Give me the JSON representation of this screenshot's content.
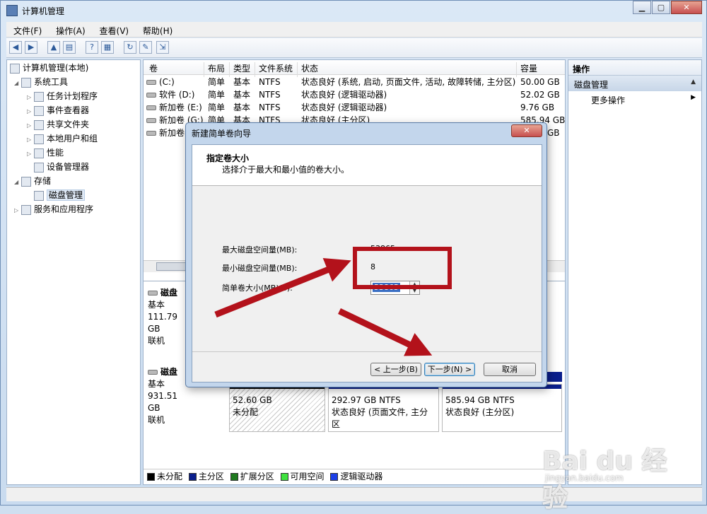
{
  "window": {
    "title": "计算机管理",
    "minimize": "▁",
    "maximize": "▢",
    "close": "✕"
  },
  "menu": [
    "文件(F)",
    "操作(A)",
    "查看(V)",
    "帮助(H)"
  ],
  "toolbar_icons": [
    "back-icon",
    "forward-icon",
    "up-folder-icon",
    "show-hide-tree-icon",
    "help-icon",
    "console-icon",
    "refresh-icon",
    "properties-icon",
    "export-icon"
  ],
  "tree": {
    "root": "计算机管理(本地)",
    "system_tools": "系统工具",
    "task_scheduler": "任务计划程序",
    "event_viewer": "事件查看器",
    "shared_folders": "共享文件夹",
    "local_users": "本地用户和组",
    "performance": "性能",
    "device_manager": "设备管理器",
    "storage": "存储",
    "disk_management": "磁盘管理",
    "services": "服务和应用程序"
  },
  "volumes": {
    "columns": [
      "卷",
      "布局",
      "类型",
      "文件系统",
      "状态",
      "容量"
    ],
    "rows": [
      [
        "(C:)",
        "简单",
        "基本",
        "NTFS",
        "状态良好 (系统, 启动, 页面文件, 活动, 故障转储, 主分区)",
        "50.00 GB"
      ],
      [
        "软件 (D:)",
        "简单",
        "基本",
        "NTFS",
        "状态良好 (逻辑驱动器)",
        "52.02 GB"
      ],
      [
        "新加卷 (E:)",
        "简单",
        "基本",
        "NTFS",
        "状态良好 (逻辑驱动器)",
        "9.76 GB"
      ],
      [
        "新加卷 (G:)",
        "简单",
        "基本",
        "NTFS",
        "状态良好 (主分区)",
        "585.94 GB"
      ],
      [
        "新加卷",
        "",
        "",
        "",
        "",
        "GB"
      ]
    ]
  },
  "disk0": {
    "name": "磁盘",
    "type": "基本",
    "size": "111.79 GB",
    "status": "联机"
  },
  "disk1": {
    "name": "磁盘",
    "type": "基本",
    "size": "931.51 GB",
    "status": "联机",
    "p1": {
      "size": "52.60 GB",
      "status": "未分配"
    },
    "p2": {
      "size": "292.97 GB NTFS",
      "status": "状态良好 (页面文件, 主分区"
    },
    "p3": {
      "size": "585.94 GB NTFS",
      "status": "状态良好 (主分区)"
    }
  },
  "legend": [
    {
      "label": "未分配",
      "color": "#000000"
    },
    {
      "label": "主分区",
      "color": "#0a1e8c"
    },
    {
      "label": "扩展分区",
      "color": "#1f7a1f"
    },
    {
      "label": "可用空间",
      "color": "#3fe23f"
    },
    {
      "label": "逻辑驱动器",
      "color": "#1c3fe6"
    }
  ],
  "actions": {
    "header": "操作",
    "section": "磁盘管理",
    "more": "更多操作"
  },
  "wizard": {
    "title": "新建简单卷向导",
    "close": "✕",
    "heading": "指定卷大小",
    "subheading": "选择介于最大和最小值的卷大小。",
    "max_label": "最大磁盘空间量(MB):",
    "max_value": "53865",
    "min_label": "最小磁盘空间量(MB):",
    "min_value": "8",
    "size_label": "简单卷大小(MB)(S):",
    "size_value": "53865",
    "back": "< 上一步(B)",
    "next": "下一步(N) >",
    "cancel": "取消"
  },
  "watermark": {
    "brand": "Bai du 经验",
    "url": "jingyan.baidu.com"
  },
  "colors": {
    "annotation_red": "#b3121b"
  }
}
